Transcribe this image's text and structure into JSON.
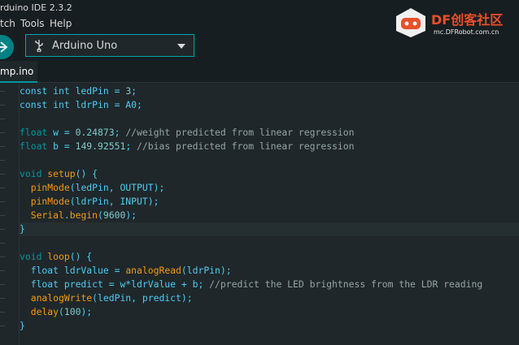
{
  "window": {
    "title": "rduino IDE 2.3.2"
  },
  "menu": [
    "tch",
    "Tools",
    "Help"
  ],
  "toolbar": {
    "board_name": "Arduino Uno"
  },
  "tabs": [
    {
      "label": "mp.ino"
    }
  ],
  "watermark": {
    "brand": "DF创客社区",
    "site": "mc.DFRobot.com.cn"
  },
  "colors": {
    "accent": "#00979c",
    "keyword": "#00979c",
    "function": "#e97366",
    "string": "#4fccf3",
    "comment": "#95a5a6",
    "background": "#1f272a"
  },
  "code_lines": [
    [
      {
        "t": "const int ",
        "c": "txt"
      },
      {
        "t": "ledPin = ",
        "c": "txt"
      },
      {
        "t": "3",
        "c": "num"
      },
      {
        "t": ";",
        "c": "txt"
      }
    ],
    [
      {
        "t": "const int ",
        "c": "txt"
      },
      {
        "t": "ldrPin = A0;",
        "c": "txt"
      }
    ],
    [],
    [
      {
        "t": "float",
        "c": "kw"
      },
      {
        "t": " w = ",
        "c": "txt"
      },
      {
        "t": "0.24873",
        "c": "num"
      },
      {
        "t": "; ",
        "c": "txt"
      },
      {
        "t": "//weight predicted from linear regression",
        "c": "cm"
      }
    ],
    [
      {
        "t": "float",
        "c": "kw"
      },
      {
        "t": " b = ",
        "c": "txt"
      },
      {
        "t": "149.92551",
        "c": "num"
      },
      {
        "t": "; ",
        "c": "txt"
      },
      {
        "t": "//bias predicted from linear regression",
        "c": "cm"
      }
    ],
    [],
    [
      {
        "t": "void",
        "c": "kw"
      },
      {
        "t": " ",
        "c": "txt"
      },
      {
        "t": "setup",
        "c": "fn2"
      },
      {
        "t": "() {",
        "c": "txt"
      }
    ],
    [
      {
        "t": "  ",
        "c": "txt"
      },
      {
        "t": "pinMode",
        "c": "fn2"
      },
      {
        "t": "(ledPin, OUTPUT);",
        "c": "txt"
      }
    ],
    [
      {
        "t": "  ",
        "c": "txt"
      },
      {
        "t": "pinMode",
        "c": "fn2"
      },
      {
        "t": "(ldrPin, INPUT);",
        "c": "txt"
      }
    ],
    [
      {
        "t": "  ",
        "c": "txt"
      },
      {
        "t": "Serial",
        "c": "fn2"
      },
      {
        "t": ".",
        "c": "txt"
      },
      {
        "t": "begin",
        "c": "fn2"
      },
      {
        "t": "(",
        "c": "txt"
      },
      {
        "t": "9600",
        "c": "num"
      },
      {
        "t": ");",
        "c": "txt"
      }
    ],
    [
      {
        "t": "}",
        "c": "txt"
      }
    ],
    [],
    [
      {
        "t": "void",
        "c": "kw"
      },
      {
        "t": " ",
        "c": "txt"
      },
      {
        "t": "loop",
        "c": "fn2"
      },
      {
        "t": "() {",
        "c": "txt"
      }
    ],
    [
      {
        "t": "  float ldrValue = ",
        "c": "txt"
      },
      {
        "t": "analogRead",
        "c": "fn2"
      },
      {
        "t": "(ldrPin);",
        "c": "txt"
      }
    ],
    [
      {
        "t": "  float predict = w*ldrValue + b; ",
        "c": "txt"
      },
      {
        "t": "//predict the LED brightness from the LDR reading",
        "c": "cm"
      }
    ],
    [
      {
        "t": "  ",
        "c": "txt"
      },
      {
        "t": "analogWrite",
        "c": "fn2"
      },
      {
        "t": "(ledPin, predict);",
        "c": "txt"
      }
    ],
    [
      {
        "t": "  ",
        "c": "txt"
      },
      {
        "t": "delay",
        "c": "fn2"
      },
      {
        "t": "(",
        "c": "txt"
      },
      {
        "t": "100",
        "c": "num"
      },
      {
        "t": ");",
        "c": "txt"
      }
    ],
    [
      {
        "t": "}",
        "c": "txt"
      }
    ]
  ]
}
